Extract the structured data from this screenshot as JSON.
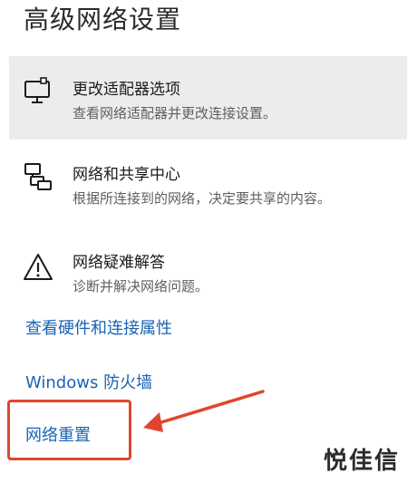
{
  "page": {
    "title": "高级网络设置"
  },
  "options": [
    {
      "title": "更改适配器选项",
      "description": "查看网络适配器并更改连接设置。",
      "icon": "monitor-network-icon",
      "selected": true
    },
    {
      "title": "网络和共享中心",
      "description": "根据所连接到的网络，决定要共享的内容。",
      "icon": "network-share-icon",
      "selected": false
    },
    {
      "title": "网络疑难解答",
      "description": "诊断并解决网络问题。",
      "icon": "warning-triangle-icon",
      "selected": false
    }
  ],
  "links": {
    "hardware_properties": "查看硬件和连接属性",
    "firewall": "Windows 防火墙",
    "network_reset": "网络重置"
  },
  "annotation": {
    "highlight_color": "#e0452d"
  },
  "watermark": {
    "text": "悦佳信"
  }
}
